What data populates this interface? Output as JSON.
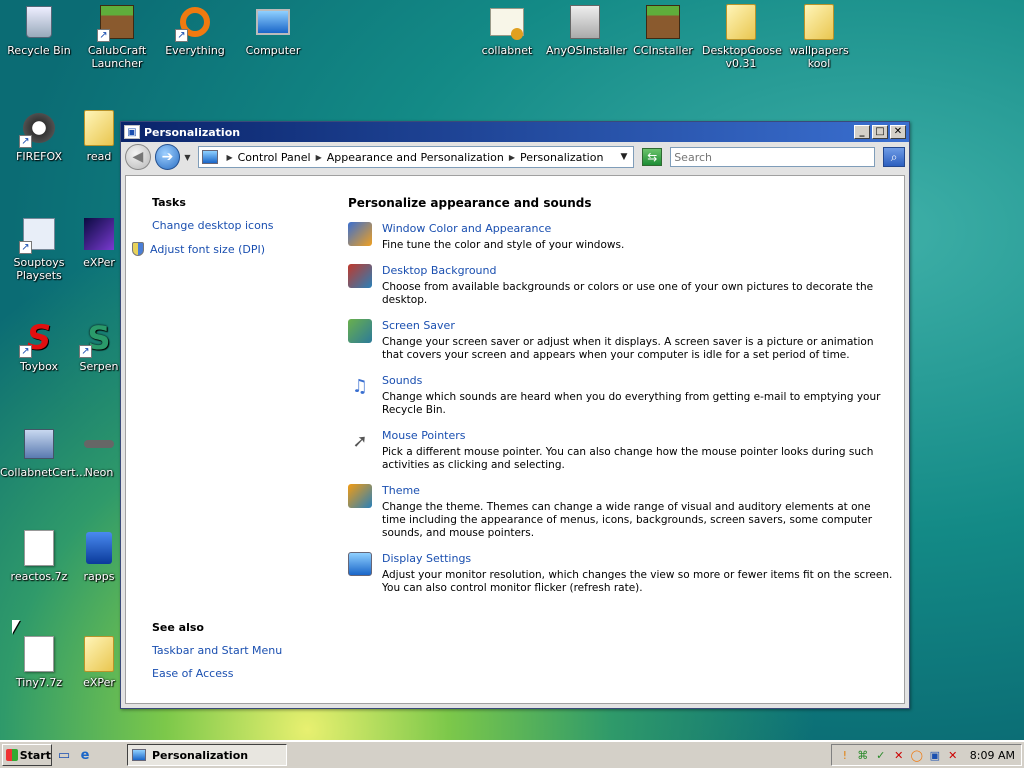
{
  "desktop": {
    "icons": [
      {
        "label": "Recycle Bin"
      },
      {
        "label": "CalubCraft Launcher"
      },
      {
        "label": "Everything"
      },
      {
        "label": "Computer"
      },
      {
        "label": "collabnet"
      },
      {
        "label": "AnyOSInstaller"
      },
      {
        "label": "CCInstaller"
      },
      {
        "label": "DesktopGoose v0.31"
      },
      {
        "label": "wallpapers kool"
      },
      {
        "label": "FIREFOX"
      },
      {
        "label": "read"
      },
      {
        "label": "Souptoys Playsets"
      },
      {
        "label": "eXPer"
      },
      {
        "label": "Toybox"
      },
      {
        "label": "Serpen"
      },
      {
        "label": "CollabnetCert..."
      },
      {
        "label": "Neon"
      },
      {
        "label": "reactos.7z"
      },
      {
        "label": "rapps"
      },
      {
        "label": "Tiny7.7z"
      },
      {
        "label": "eXPer"
      }
    ]
  },
  "window": {
    "title": "Personalization",
    "breadcrumb": [
      "Control Panel",
      "Appearance and Personalization",
      "Personalization"
    ],
    "search_placeholder": "Search",
    "tasks": {
      "heading": "Tasks",
      "links": [
        "Change desktop icons",
        "Adjust font size (DPI)"
      ]
    },
    "see_also": {
      "heading": "See also",
      "links": [
        "Taskbar and Start Menu",
        "Ease of Access"
      ]
    },
    "main": {
      "heading": "Personalize appearance and sounds",
      "items": [
        {
          "title": "Window Color and Appearance",
          "desc": "Fine tune the color and style of your windows.",
          "icon": "window-color-icon"
        },
        {
          "title": "Desktop Background",
          "desc": "Choose from available backgrounds or colors or use one of your own pictures to decorate the desktop.",
          "icon": "desktop-background-icon"
        },
        {
          "title": "Screen Saver",
          "desc": "Change your screen saver or adjust when it displays. A screen saver is a picture or animation that covers your screen and appears when your computer is idle for a set period of time.",
          "icon": "screen-saver-icon"
        },
        {
          "title": "Sounds",
          "desc": "Change which sounds are heard when you do everything from getting e-mail to emptying your Recycle Bin.",
          "icon": "sounds-icon"
        },
        {
          "title": "Mouse Pointers",
          "desc": "Pick a different mouse pointer. You can also change how the mouse pointer looks during such activities as clicking and selecting.",
          "icon": "mouse-pointer-icon"
        },
        {
          "title": "Theme",
          "desc": "Change the theme. Themes can change a wide range of visual and auditory elements at one time including the appearance of menus, icons, backgrounds, screen savers, some computer sounds, and mouse pointers.",
          "icon": "theme-icon"
        },
        {
          "title": "Display Settings",
          "desc": "Adjust your monitor resolution, which changes the view so more or fewer items fit on the screen. You can also control monitor flicker (refresh rate).",
          "icon": "display-settings-icon"
        }
      ]
    }
  },
  "taskbar": {
    "start_label": "Start",
    "task_button_label": "Personalization",
    "clock": "8:09 AM"
  },
  "colors": {
    "title_bar": "#0a246a",
    "link": "#1a4fb0",
    "taskbar": "#d4d0c8"
  }
}
